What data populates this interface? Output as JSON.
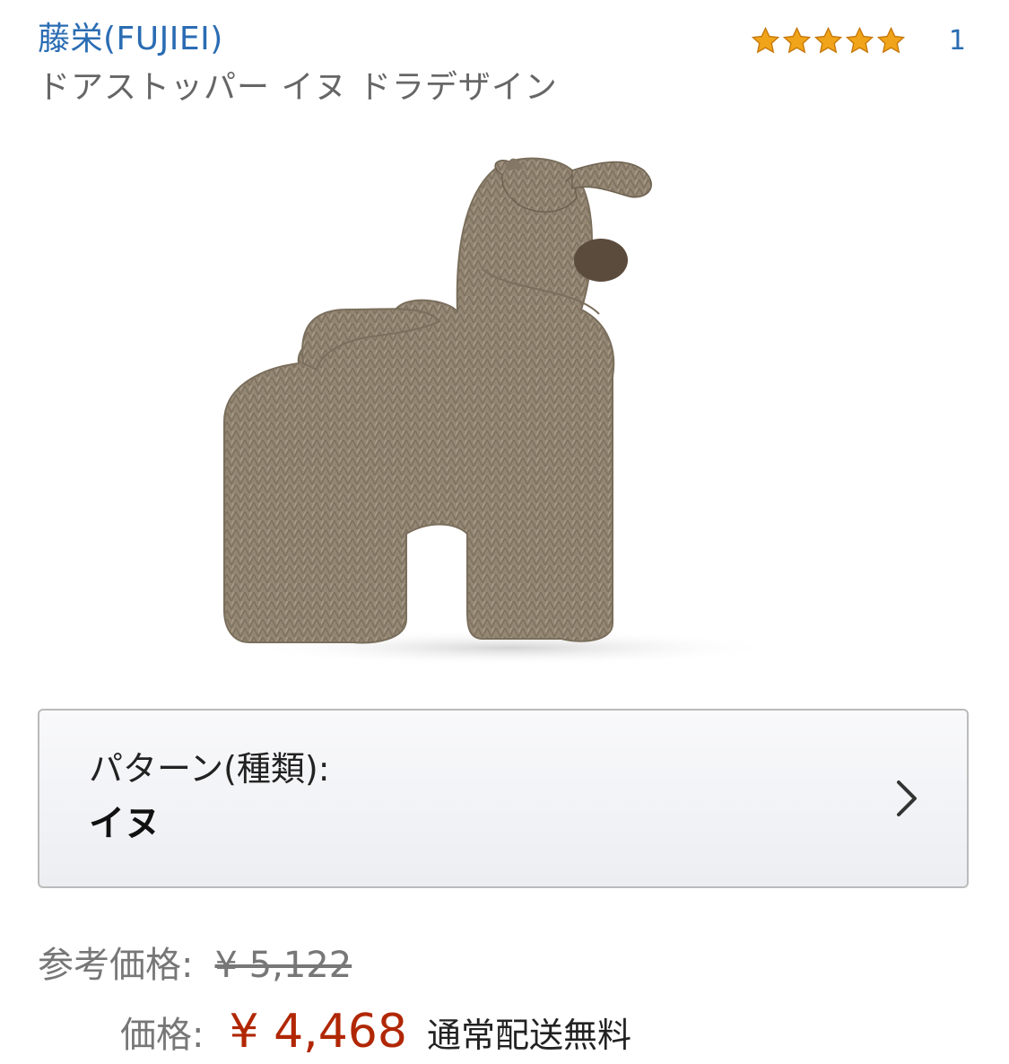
{
  "brand": "藤栄(FUJIEI)",
  "rating": {
    "stars": 5,
    "count": "1",
    "star_color": "#f0a419",
    "star_stroke": "#c7780a"
  },
  "product_title": "ドアストッパー イヌ ドラデザイン",
  "product_image": {
    "alt": "tweed dog doorstop"
  },
  "variation": {
    "label": "パターン(種類):",
    "value": "イヌ",
    "icon": "chevron-right-icon"
  },
  "pricing": {
    "list_price_label": "参考価格:",
    "list_price_value": "¥ 5,122",
    "price_label": "価格:",
    "price_value": "¥ 4,468",
    "shipping": "通常配送無料",
    "price_color": "#b12704"
  },
  "colors": {
    "link": "#2a6cb3"
  }
}
